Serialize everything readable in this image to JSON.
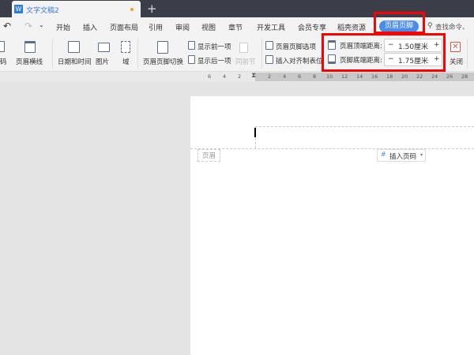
{
  "title_bar": {
    "doc_tab": "文字文稿2",
    "app_icon": "W",
    "new_tab": "+"
  },
  "menu": {
    "items": [
      "开始",
      "插入",
      "页面布局",
      "引用",
      "审阅",
      "视图",
      "章节",
      "开发工具",
      "会员专享",
      "稻壳资源",
      "页眉页脚"
    ],
    "active": "页眉页脚",
    "search_placeholder": "查找命令、搜"
  },
  "ribbon": {
    "left_partial": "码",
    "header_line": "页眉横线",
    "datetime": "日期和时间",
    "picture": "图片",
    "field": "域",
    "switch": "页眉页脚切换",
    "show_prev": "显示前一项",
    "show_next": "显示后一项",
    "same_prev": "同前节",
    "options": "页眉页脚选项",
    "insert_align_tab": "插入对齐制表位",
    "header_top_label": "页眉顶端距离:",
    "header_top_value": "1.50厘米",
    "footer_bottom_label": "页脚底端距离:",
    "footer_bottom_value": "1.75厘米",
    "minus": "−",
    "plus": "+",
    "close": "关闭"
  },
  "ruler": {
    "ticks": [
      "6",
      "4",
      "2",
      "2",
      "4",
      "6",
      "8",
      "10",
      "12",
      "14",
      "16",
      "18",
      "20",
      "22",
      "24",
      "26",
      "28"
    ]
  },
  "document": {
    "header_label": "页眉",
    "insert_page_number": "插入页码"
  },
  "colors": {
    "accent": "#4a8de8",
    "highlight": "#ff0000"
  }
}
